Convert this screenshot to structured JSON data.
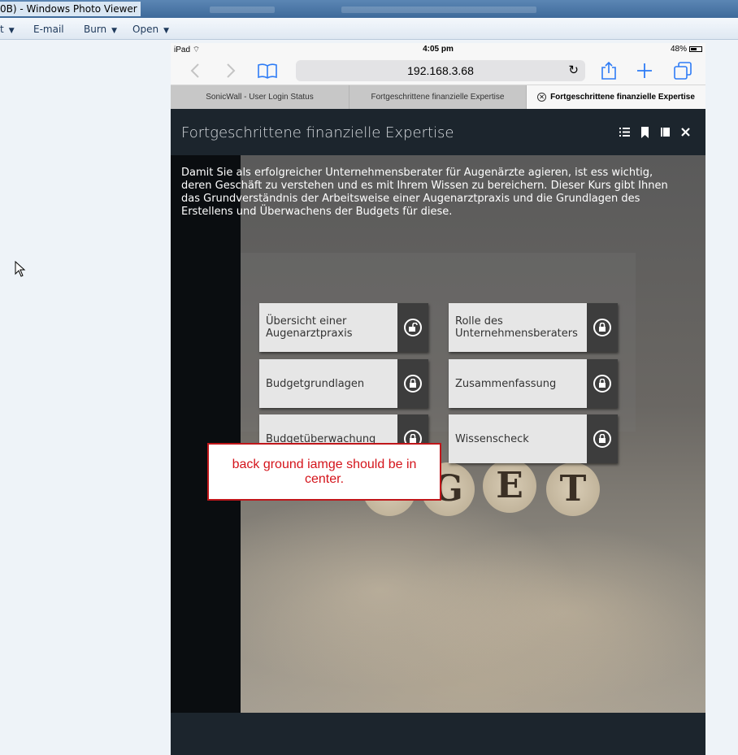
{
  "window": {
    "title": "0B) - Windows Photo Viewer"
  },
  "menu": {
    "items": [
      {
        "label": "t",
        "has_caret": true
      },
      {
        "label": "E-mail",
        "has_caret": false
      },
      {
        "label": "Burn",
        "has_caret": true
      },
      {
        "label": "Open",
        "has_caret": true
      }
    ]
  },
  "ipad": {
    "status": {
      "device": "iPad",
      "time": "4:05 pm",
      "battery": "48%"
    },
    "url": "192.168.3.68",
    "tabs": [
      {
        "label": "SonicWall - User Login Status",
        "active": false
      },
      {
        "label": "Fortgeschrittene finanzielle Expertise",
        "active": false
      },
      {
        "label": "Fortgeschrittene finanzielle Expertise",
        "active": true
      }
    ]
  },
  "course": {
    "title": "Fortgeschrittene finanzielle Expertise",
    "header_icons": [
      "list-icon",
      "bookmark-icon",
      "book-icon",
      "close-icon"
    ],
    "intro": "Damit Sie als erfolgreicher Unternehmensberater für Augenärzte agieren, ist ess wichtig, deren Geschäft zu verstehen und es mit Ihrem Wissen zu bereichern. Dieser Kurs gibt Ihnen das Grundverständnis der Arbeitsweise einer Augenarztpraxis und die Grundlagen des Erstellens und Überwachens der Budgets für diese.",
    "modules": [
      {
        "label": "Übersicht einer Augenarztpraxis",
        "icon": "unlock-icon"
      },
      {
        "label": "Rolle des Unternehmensberaters",
        "icon": "lock-icon"
      },
      {
        "label": "Budgetgrundlagen",
        "icon": "lock-icon"
      },
      {
        "label": "Zusammenfassung",
        "icon": "lock-icon"
      },
      {
        "label": "Budgetüberwachung",
        "icon": "lock-icon"
      },
      {
        "label": "Wissenscheck",
        "icon": "lock-icon"
      }
    ],
    "background_letters": [
      "G",
      "E",
      "T",
      "D"
    ]
  },
  "annotation": {
    "text": "back ground iamge should be in center."
  },
  "colors": {
    "note_red": "#d4141b",
    "ios_blue": "#2e7cf6",
    "course_header": "#1c252d"
  }
}
